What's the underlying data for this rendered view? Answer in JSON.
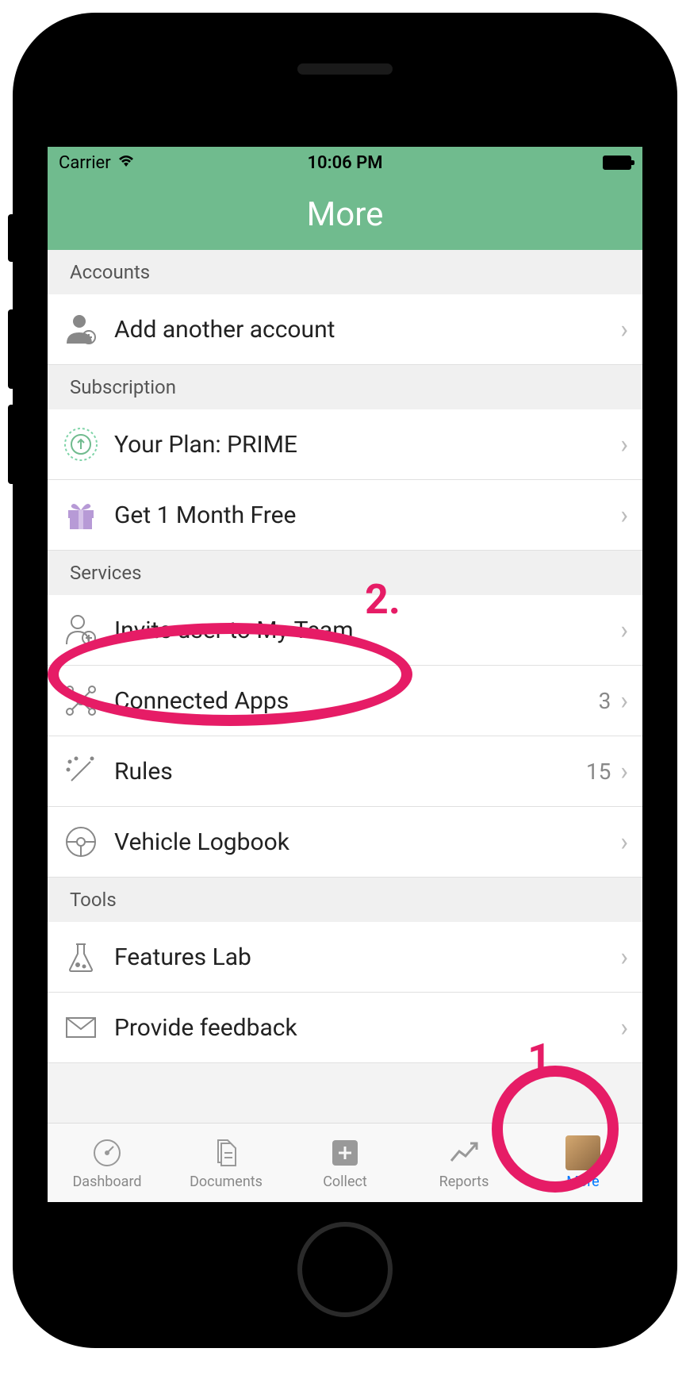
{
  "status": {
    "carrier": "Carrier",
    "time": "10:06 PM"
  },
  "header": {
    "title": "More"
  },
  "sections": {
    "accounts": {
      "title": "Accounts"
    },
    "subscription": {
      "title": "Subscription"
    },
    "services": {
      "title": "Services"
    },
    "tools": {
      "title": "Tools"
    }
  },
  "rows": {
    "addAccount": {
      "label": "Add another account"
    },
    "plan": {
      "label": "Your Plan: PRIME"
    },
    "monthFree": {
      "label": "Get 1 Month Free"
    },
    "invite": {
      "label": "Invite user to My Team"
    },
    "connectedApps": {
      "label": "Connected Apps",
      "badge": "3"
    },
    "rules": {
      "label": "Rules",
      "badge": "15"
    },
    "vehicle": {
      "label": "Vehicle Logbook"
    },
    "featuresLab": {
      "label": "Features Lab"
    },
    "feedback": {
      "label": "Provide feedback"
    }
  },
  "tabs": {
    "dashboard": "Dashboard",
    "documents": "Documents",
    "collect": "Collect",
    "reports": "Reports",
    "more": "More"
  },
  "annotations": {
    "one": "1.",
    "two": "2."
  }
}
